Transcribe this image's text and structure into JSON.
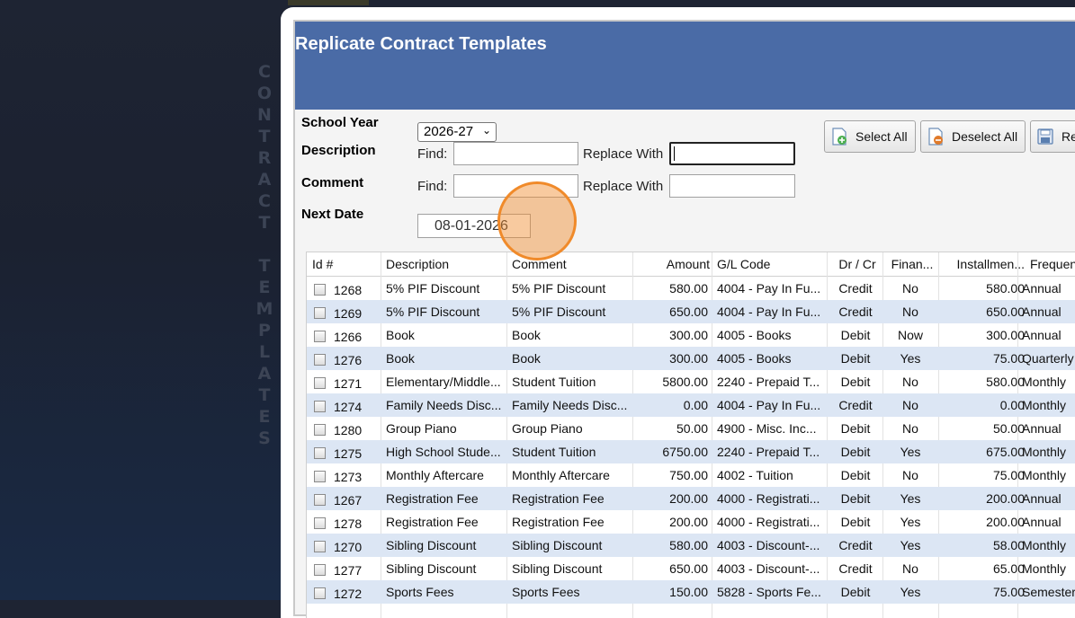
{
  "side_title": [
    "C",
    "O",
    "N",
    "T",
    "R",
    "A",
    "C",
    "T",
    " ",
    "T",
    "E",
    "M",
    "P",
    "L",
    "A",
    "T",
    "E",
    "S"
  ],
  "header": {
    "title": "Replicate Contract Templates"
  },
  "form": {
    "school_year_label": "School Year",
    "school_year_value": "2026-27",
    "description_label": "Description",
    "comment_label": "Comment",
    "next_date_label": "Next Date",
    "next_date_value": "08-01-2026",
    "find_label": "Find:",
    "replace_label": "Replace With"
  },
  "toolbar": {
    "select_all": "Select All",
    "deselect_all": "Deselect All",
    "replicate": "Re"
  },
  "table": {
    "headers": [
      "Id #",
      "Description",
      "Comment",
      "Amount",
      "G/L Code",
      "Dr / Cr",
      "Finan...",
      "Installmen...",
      "Frequen..."
    ],
    "rows": [
      [
        "1268",
        "5% PIF Discount",
        "5% PIF Discount",
        "580.00",
        "4004 - Pay In Fu...",
        "Credit",
        "No",
        "580.00",
        "Annual"
      ],
      [
        "1269",
        "5% PIF Discount",
        "5% PIF Discount",
        "650.00",
        "4004 - Pay In Fu...",
        "Credit",
        "No",
        "650.00",
        "Annual"
      ],
      [
        "1266",
        "Book",
        "Book",
        "300.00",
        "4005 - Books",
        "Debit",
        "Now",
        "300.00",
        "Annual"
      ],
      [
        "1276",
        "Book",
        "Book",
        "300.00",
        "4005 - Books",
        "Debit",
        "Yes",
        "75.00",
        "Quarterly"
      ],
      [
        "1271",
        "Elementary/Middle...",
        "Student Tuition",
        "5800.00",
        "2240 - Prepaid T...",
        "Debit",
        "No",
        "580.00",
        "Monthly"
      ],
      [
        "1274",
        "Family Needs Disc...",
        "Family Needs Disc...",
        "0.00",
        "4004 - Pay In Fu...",
        "Credit",
        "No",
        "0.00",
        "Monthly"
      ],
      [
        "1280",
        "Group Piano",
        "Group Piano",
        "50.00",
        "4900 - Misc. Inc...",
        "Debit",
        "No",
        "50.00",
        "Annual"
      ],
      [
        "1275",
        "High School Stude...",
        "Student Tuition",
        "6750.00",
        "2240 - Prepaid T...",
        "Debit",
        "Yes",
        "675.00",
        "Monthly"
      ],
      [
        "1273",
        "Monthly Aftercare",
        "Monthly Aftercare",
        "750.00",
        "4002 - Tuition",
        "Debit",
        "No",
        "75.00",
        "Monthly"
      ],
      [
        "1267",
        "Registration Fee",
        "Registration Fee",
        "200.00",
        "4000 - Registrati...",
        "Debit",
        "Yes",
        "200.00",
        "Annual"
      ],
      [
        "1278",
        "Registration Fee",
        "Registration Fee",
        "200.00",
        "4000 - Registrati...",
        "Debit",
        "Yes",
        "200.00",
        "Annual"
      ],
      [
        "1270",
        "Sibling Discount",
        "Sibling Discount",
        "580.00",
        "4003 - Discount-...",
        "Credit",
        "Yes",
        "58.00",
        "Monthly"
      ],
      [
        "1277",
        "Sibling Discount",
        "Sibling Discount",
        "650.00",
        "4003 - Discount-...",
        "Credit",
        "No",
        "65.00",
        "Monthly"
      ],
      [
        "1272",
        "Sports Fees",
        "Sports Fees",
        "150.00",
        "5828 - Sports Fe...",
        "Debit",
        "Yes",
        "75.00",
        "Semester"
      ]
    ]
  }
}
